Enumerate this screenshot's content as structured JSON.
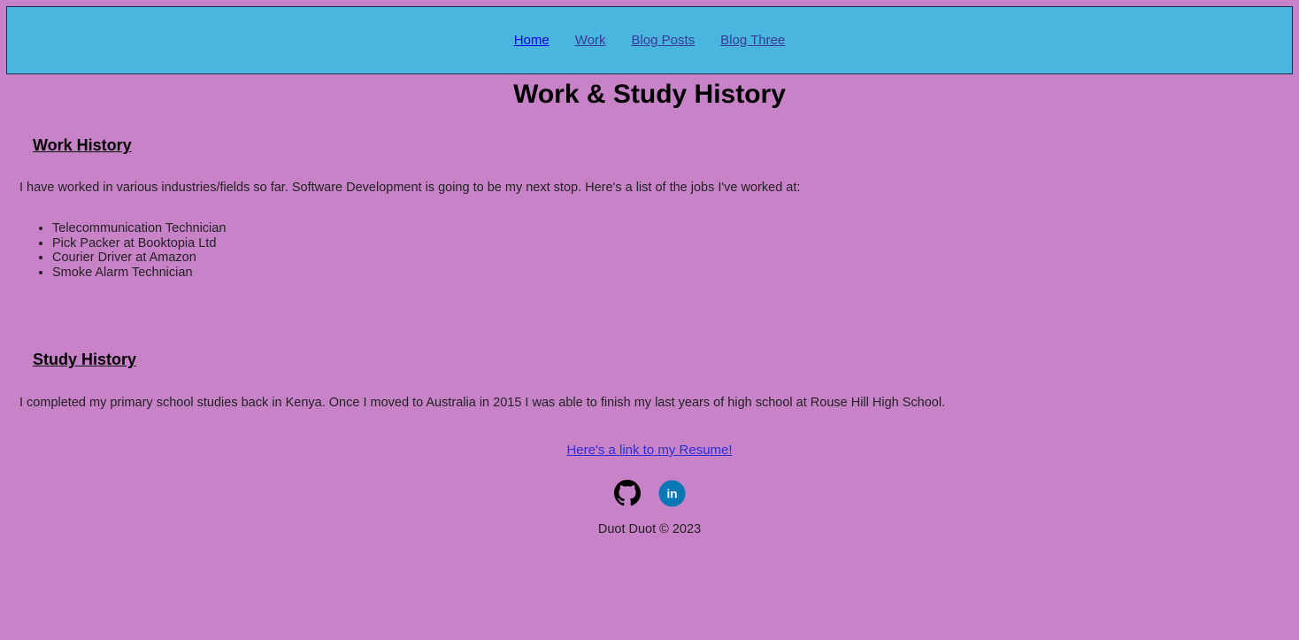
{
  "nav": {
    "items": [
      {
        "label": "Home",
        "active": true
      },
      {
        "label": "Work",
        "active": false
      },
      {
        "label": "Blog Posts",
        "active": false
      },
      {
        "label": "Blog Three",
        "active": false
      }
    ]
  },
  "page_title": "Work & Study History",
  "work": {
    "heading": "Work History",
    "intro": "I have worked in various industries/fields so far. Software Development is going to be my next stop. Here's a list of the jobs I've worked at:",
    "jobs": [
      "Telecommunication Technician",
      "Pick Packer at Booktopia Ltd",
      "Courier Driver at Amazon",
      "Smoke Alarm Technician"
    ]
  },
  "study": {
    "heading": "Study History",
    "text": "I completed my primary school studies back in Kenya. Once I moved to Australia in 2015 I was able to finish my last years of high school at Rouse Hill High School."
  },
  "resume_link": "Here's a link to my Resume!",
  "social": {
    "icons": [
      "github-icon",
      "linkedin-icon"
    ],
    "linkedin_label": "in",
    "linkedin_color": "#0a77b5"
  },
  "footer": "Duot Duot © 2023",
  "colors": {
    "background": "#c882c8",
    "nav_background": "#4ab5de",
    "link": "#2d2dd6"
  }
}
